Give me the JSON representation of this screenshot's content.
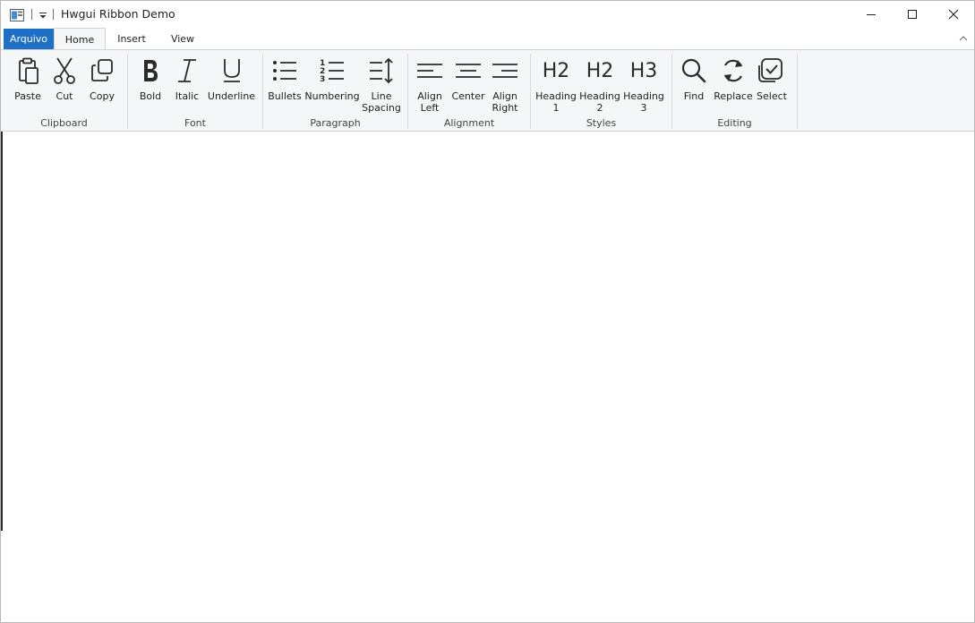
{
  "window": {
    "title": "Hwgui Ribbon Demo"
  },
  "tabs": {
    "file": "Arquivo",
    "home": "Home",
    "insert": "Insert",
    "view": "View"
  },
  "groups": {
    "clipboard": {
      "label": "Clipboard",
      "paste": "Paste",
      "cut": "Cut",
      "copy": "Copy"
    },
    "font": {
      "label": "Font",
      "bold": "Bold",
      "italic": "Italic",
      "underline": "Underline"
    },
    "paragraph": {
      "label": "Paragraph",
      "bullets": "Bullets",
      "numbering": "Numbering",
      "line_spacing_1": "Line",
      "line_spacing_2": "Spacing"
    },
    "alignment": {
      "label": "Alignment",
      "align_left_1": "Align",
      "align_left_2": "Left",
      "center": "Center",
      "align_right_1": "Align",
      "align_right_2": "Right"
    },
    "styles": {
      "label": "Styles",
      "h1_icon": "H2",
      "h2_icon": "H2",
      "h3_icon": "H3",
      "h1_label": "Heading",
      "h1_num": "1",
      "h2_label": "Heading",
      "h2_num": "2",
      "h3_label": "Heading",
      "h3_num": "3"
    },
    "editing": {
      "label": "Editing",
      "find": "Find",
      "replace": "Replace",
      "select": "Select"
    }
  },
  "colors": {
    "file_tab": "#1e6fc6",
    "ribbon_bg": "#f5f6f7",
    "icon": "#2b2b2b"
  }
}
